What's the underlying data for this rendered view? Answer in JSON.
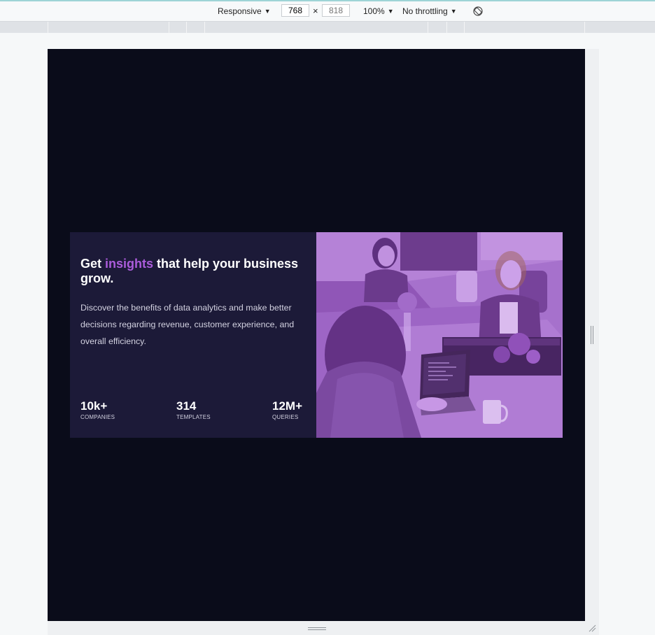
{
  "devtools": {
    "device_mode": "Responsive",
    "width_value": "768",
    "height_placeholder": "818",
    "zoom": "100%",
    "throttling": "No throttling"
  },
  "hero": {
    "headline_pre": "Get ",
    "headline_accent": "insights",
    "headline_post": " that help your business grow.",
    "description": "Discover the benefits of data analytics and make better decisions regarding revenue, customer experience, and overall efficiency.",
    "stats": [
      {
        "value": "10k+",
        "label": "COMPANIES"
      },
      {
        "value": "314",
        "label": "TEMPLATES"
      },
      {
        "value": "12M+",
        "label": "QUERIES"
      }
    ]
  },
  "colors": {
    "page_bg": "#0a0c1a",
    "card_bg": "#1c1a38",
    "accent": "#ab5cdb",
    "photo_tint": "#aa5cdb"
  }
}
